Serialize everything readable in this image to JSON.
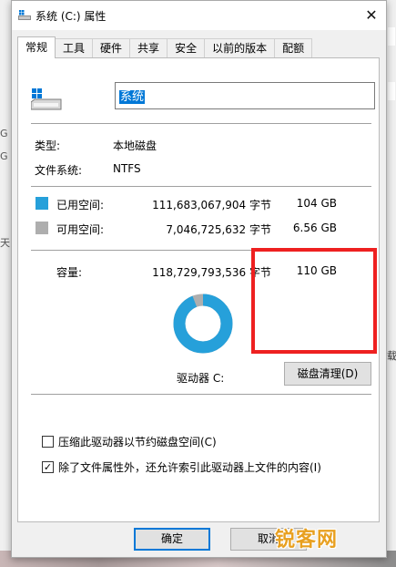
{
  "window": {
    "title": "系统 (C:) 属性",
    "close_glyph": "✕"
  },
  "tabs": [
    {
      "label": "常规",
      "active": true
    },
    {
      "label": "工具"
    },
    {
      "label": "硬件"
    },
    {
      "label": "共享"
    },
    {
      "label": "安全"
    },
    {
      "label": "以前的版本"
    },
    {
      "label": "配额"
    }
  ],
  "general": {
    "drive_name": "系统",
    "type_label": "类型:",
    "type_value": "本地磁盘",
    "fs_label": "文件系统:",
    "fs_value": "NTFS",
    "used_label": "已用空间:",
    "used_bytes": "111,683,067,904 字节",
    "used_gb": "104 GB",
    "free_label": "可用空间:",
    "free_bytes": "7,046,725,632 字节",
    "free_gb": "6.56 GB",
    "capacity_label": "容量:",
    "capacity_bytes": "118,729,793,536 字节",
    "capacity_gb": "110 GB",
    "drive_label": "驱动器 C:",
    "cleanup_button": "磁盘清理(D)",
    "compress_label": "压缩此驱动器以节约磁盘空间(C)",
    "compress_checked": false,
    "index_label": "除了文件属性外，还允许索引此驱动器上文件的内容(I)",
    "index_checked": true,
    "check_glyph": "✓"
  },
  "usage": {
    "used_fraction": 0.9407,
    "used_color": "#26a0da",
    "free_color": "#aeaeae"
  },
  "buttons": {
    "ok": "确定",
    "cancel": "取消"
  },
  "background_fragments": [
    "G",
    "G",
    "天",
    "载"
  ],
  "watermark": "锐客网"
}
